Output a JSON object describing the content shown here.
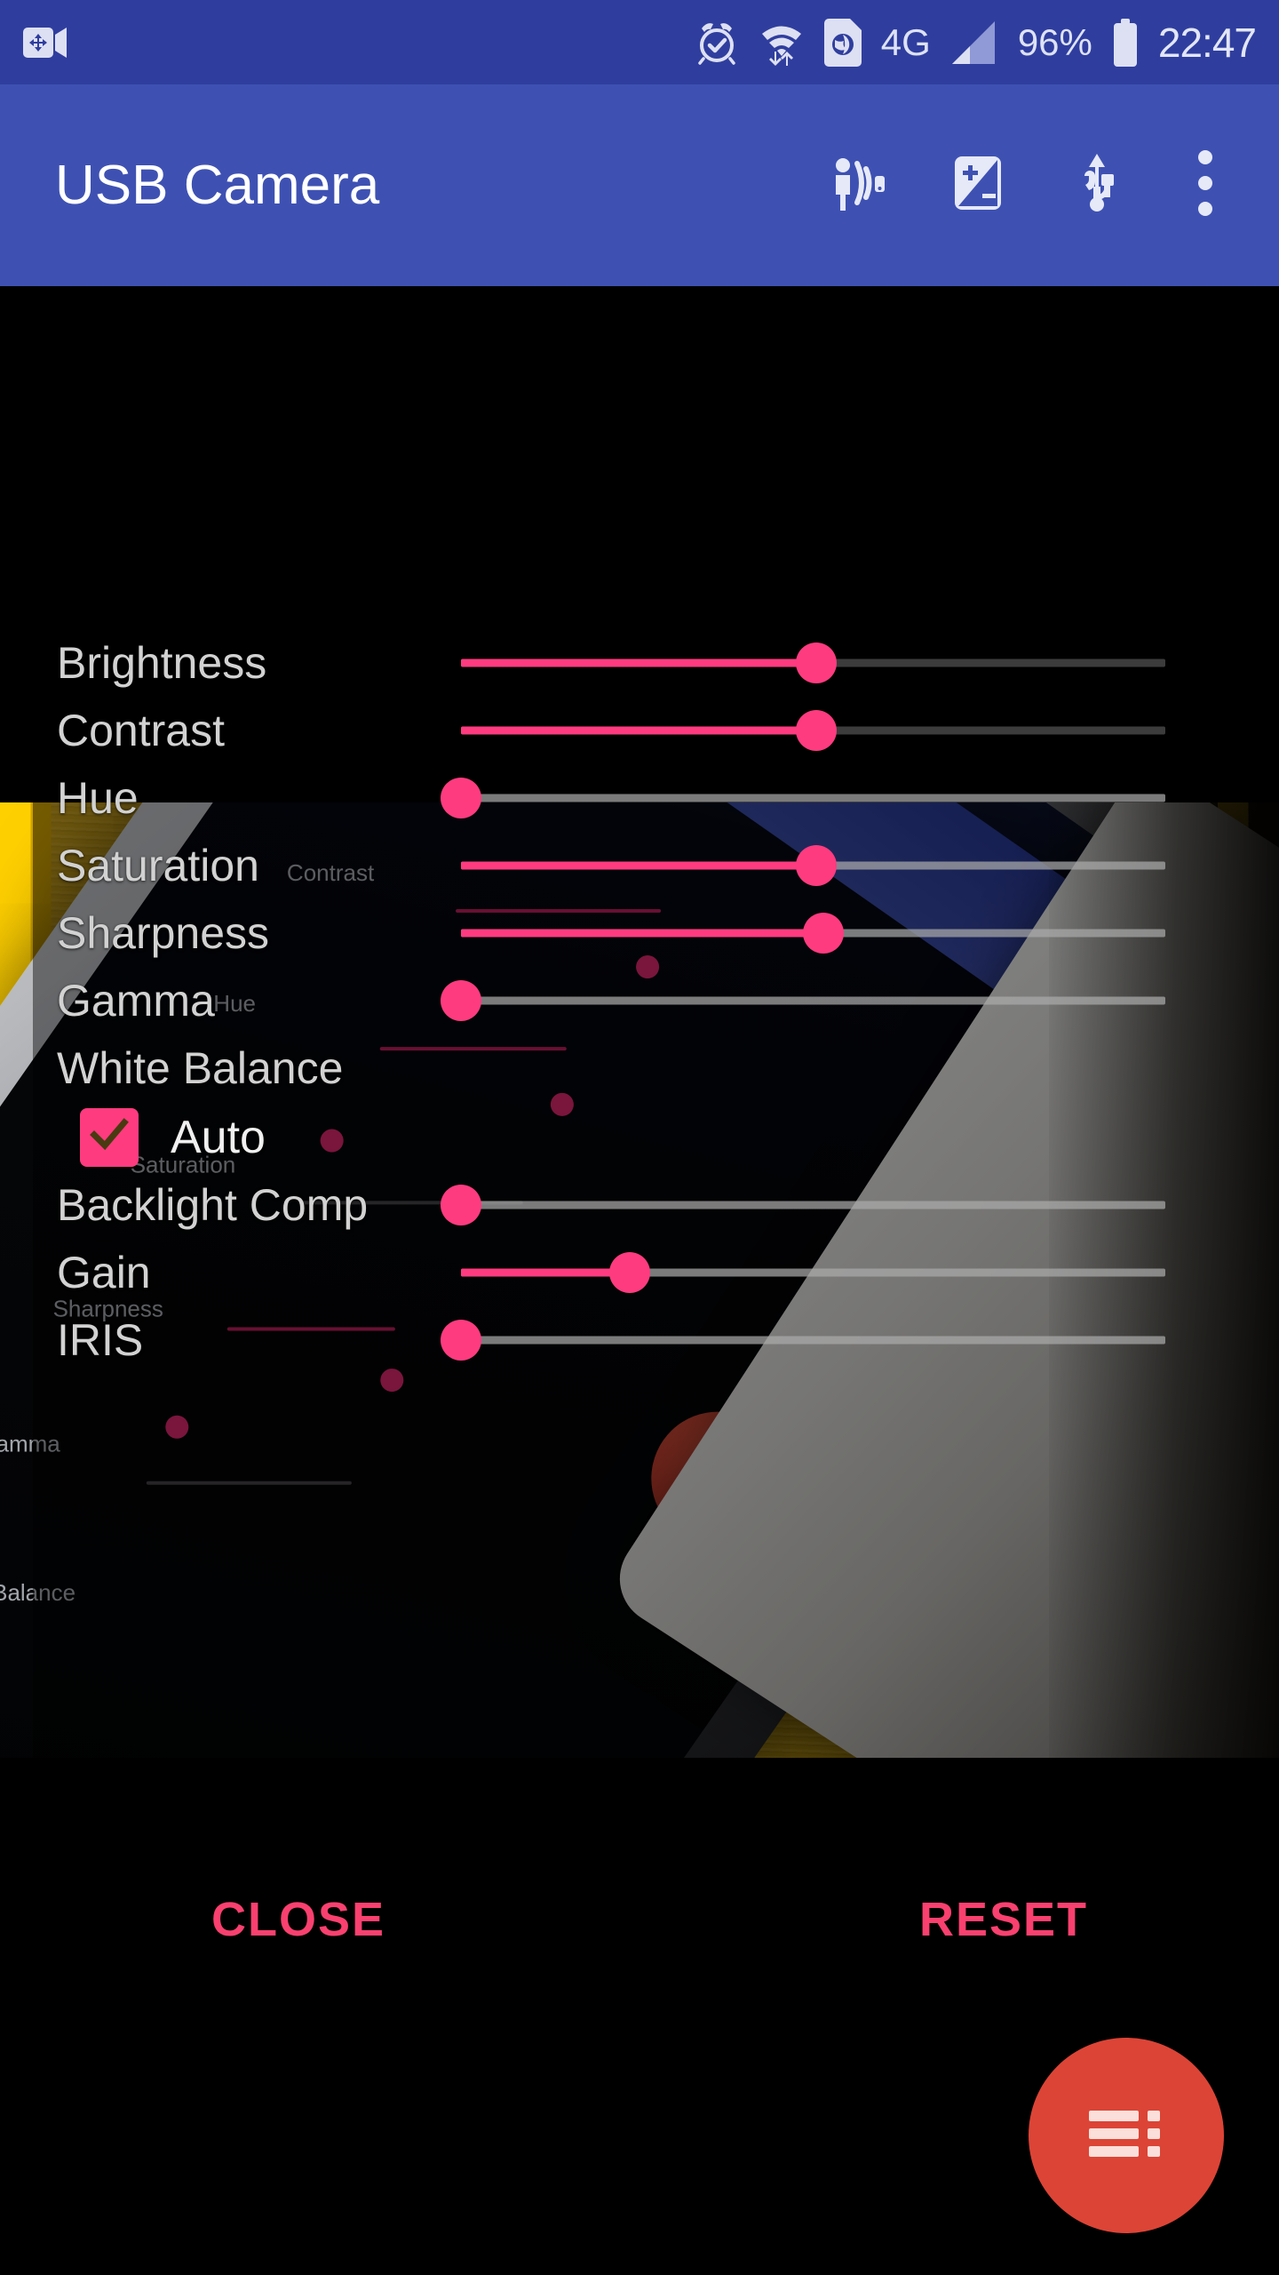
{
  "status_bar": {
    "left_icons": [
      "screen-record-icon"
    ],
    "right_icons": [
      "alarm-icon",
      "wifi-transfer-icon",
      "sim-globe-icon",
      "mobile-signal-icon"
    ],
    "network_label": "4G",
    "battery_percent": "96%",
    "clock": "22:47",
    "background_color": "#2f3e9e"
  },
  "app_bar": {
    "title": "USB Camera",
    "background_color": "#3e51b3",
    "actions": [
      {
        "name": "proximity-gesture-icon",
        "label": "Gesture"
      },
      {
        "name": "exposure-compensation-icon",
        "label": "Exposure"
      },
      {
        "name": "usb-icon",
        "label": "USB device"
      },
      {
        "name": "overflow-menu-icon",
        "label": "More options"
      }
    ]
  },
  "settings_dialog": {
    "accent_color": "#ff3b7f",
    "sliders": [
      {
        "label": "Brightness",
        "value_pct": 50.5,
        "on_black": true
      },
      {
        "label": "Contrast",
        "value_pct": 50.5,
        "on_black": true
      },
      {
        "label": "Hue",
        "value_pct": 0,
        "on_black": false
      },
      {
        "label": "Saturation",
        "value_pct": 50.5,
        "on_black": false
      },
      {
        "label": "Sharpness",
        "value_pct": 51.5,
        "on_black": false
      },
      {
        "label": "Gamma",
        "value_pct": 0,
        "on_black": false
      },
      {
        "label": "White Balance",
        "value_pct": null,
        "on_black": false
      },
      {
        "label": "Backlight Comp",
        "value_pct": 0,
        "on_black": false
      },
      {
        "label": "Gain",
        "value_pct": 24,
        "on_black": false
      },
      {
        "label": "IRIS",
        "value_pct": 0,
        "on_black": false
      }
    ],
    "white_balance_auto": {
      "label": "Auto",
      "checked": true,
      "checkbox_color": "#ff3b7f"
    },
    "buttons": {
      "close_label": "CLOSE",
      "reset_label": "RESET",
      "text_color": "#f9406f"
    }
  },
  "fab": {
    "name": "list-menu-fab",
    "icon": "list-icon",
    "background_color": "#dc4436"
  },
  "preview": {
    "name": "camera-preview",
    "description": "Live USB camera preview showing a phone on a yellow wooden table"
  }
}
